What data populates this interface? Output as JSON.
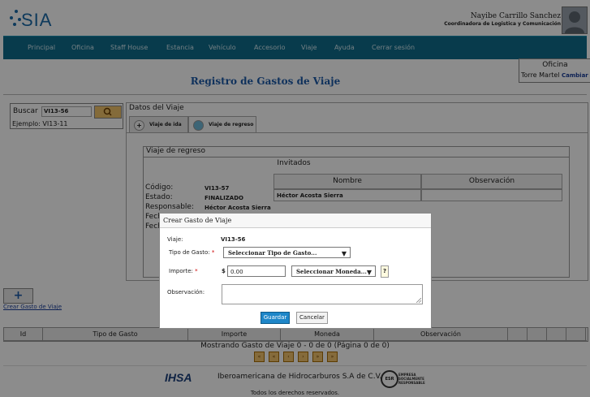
{
  "header": {
    "logo": "SIA",
    "user_name": "Nayibe Carrillo Sanchez",
    "user_role": "Coordinadora de Logistica y Comunicación"
  },
  "nav": [
    "Principal",
    "Oficina",
    "Staff House",
    "Estancia",
    "Vehículo",
    "Accesorio",
    "Viaje",
    "Ayuda",
    "Cerrar sesión"
  ],
  "office": {
    "title": "Oficina",
    "name": "Torre Martel",
    "change": "Cambiar"
  },
  "page_title": "Registro de Gastos de Viaje",
  "search": {
    "label": "Buscar",
    "value": "VI13-56",
    "example": "Ejemplo: VI13-11"
  },
  "trip": {
    "legend": "Datos del Viaje",
    "tabs": [
      "Viaje de ida",
      "Viaje de regreso"
    ],
    "section_title": "Viaje de regreso",
    "guests_title": "Invitados",
    "fields": [
      {
        "label": "Código:",
        "value": "VI13-57"
      },
      {
        "label": "Estado:",
        "value": "FINALIZADO"
      },
      {
        "label": "Responsable:",
        "value": "Héctor Acosta Sierra"
      },
      {
        "label": "Fech",
        "value": ""
      },
      {
        "label": "Fech",
        "value": ""
      }
    ],
    "guests_headers": [
      "Nombre",
      "Observación"
    ],
    "guests_rows": [
      {
        "name": "Héctor Acosta Sierra",
        "obs": ""
      }
    ]
  },
  "add": {
    "label": "Crear Gasto de Viaje"
  },
  "expenses": {
    "headers": [
      "Id",
      "Tipo de Gasto",
      "Importe",
      "Moneda",
      "Observación"
    ],
    "status": "Mostrando Gasto de Viaje 0 - 0 de 0 (Página 0 de 0)",
    "pager": [
      "«",
      "«",
      "‹",
      "›",
      "»",
      "»"
    ]
  },
  "footer": {
    "company": "Iberoamericana de Hidrocarburos S.A de C.V.",
    "logo_text": "IHSA",
    "esr_text": "EMPRESA SOCIALMENTE RESPONSABLE",
    "esr_badge": "ESR",
    "rights": "Todos los derechos reservados."
  },
  "modal": {
    "title": "Crear Gasto de Viaje",
    "trip_label": "Viaje:",
    "trip_value": "VI13-56",
    "type_label": "Tipo de Gasto:",
    "type_value": "Seleccionar Tipo de Gasto...",
    "amount_label": "Importe:",
    "currency_symbol": "$",
    "amount_value": "0.00",
    "currency_value": "Seleccionar Moneda...",
    "help": "?",
    "obs_label": "Observación:",
    "required_mark": "*",
    "save": "Guardar",
    "cancel": "Cancelar"
  }
}
